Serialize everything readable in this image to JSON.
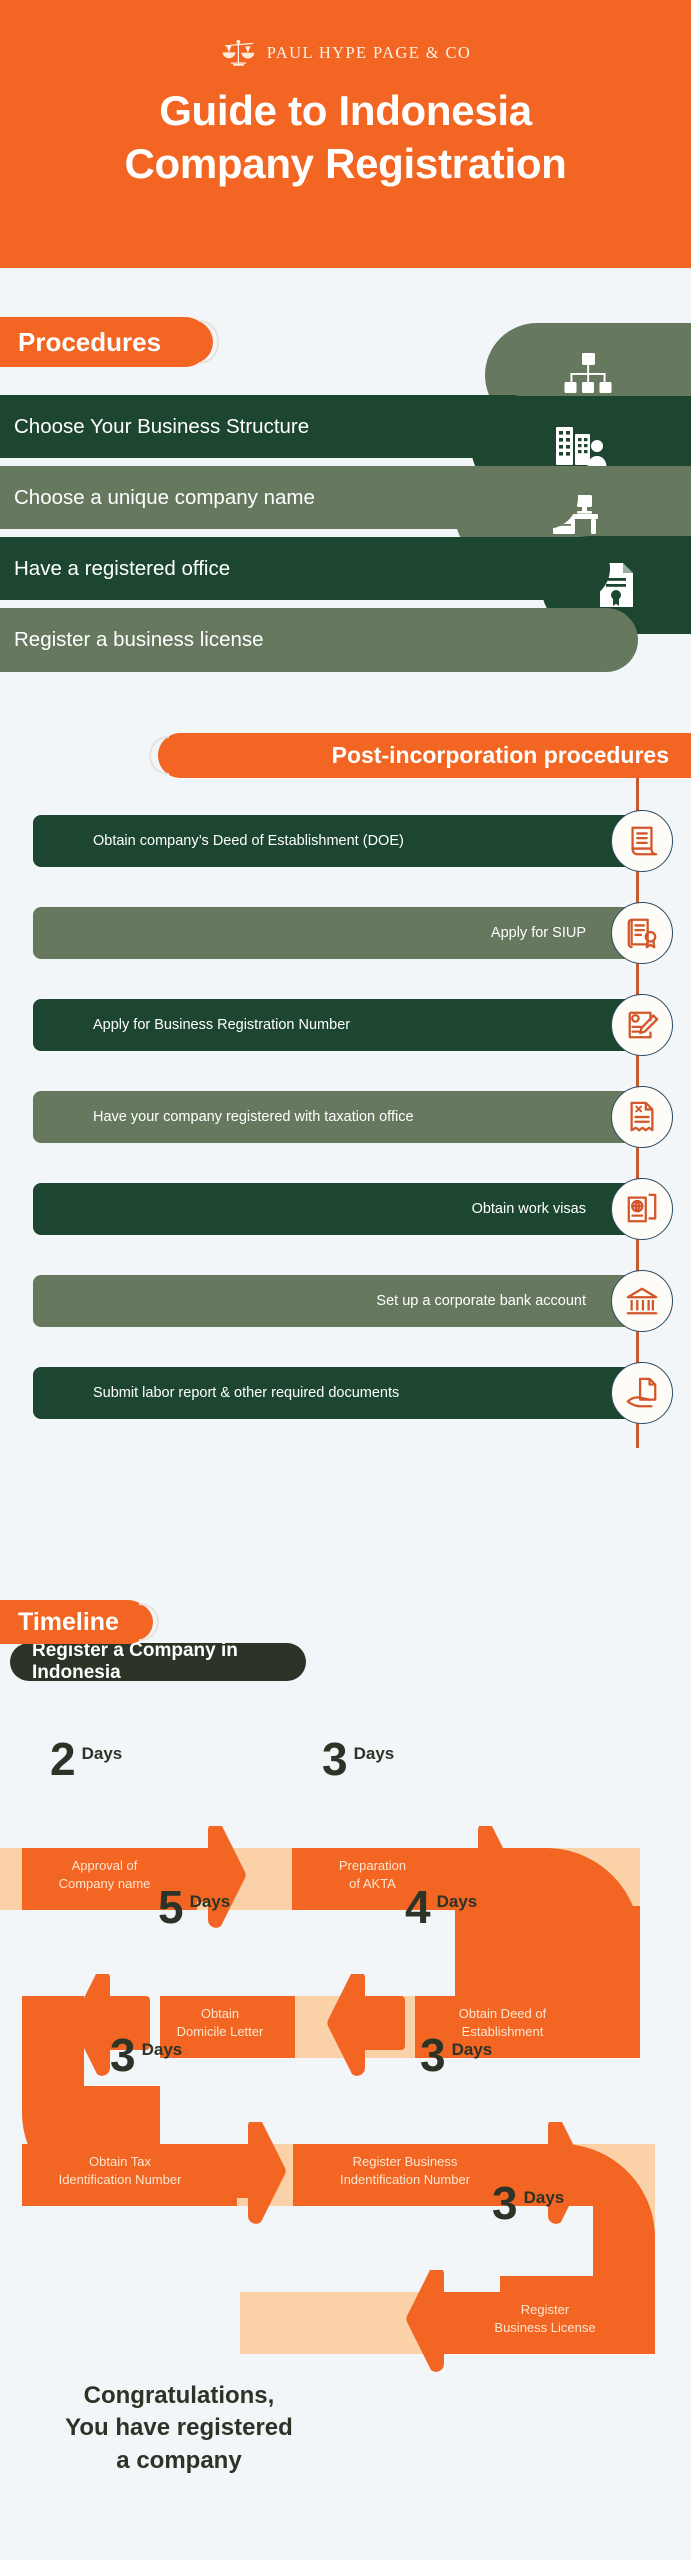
{
  "brand": {
    "orange": "#f26522",
    "orange_light": "#fbd2a8",
    "green_dark": "#1d4630",
    "green_light": "#66795f",
    "ink": "#2c3327",
    "background": "#f2f6f8",
    "logo_text": "PAUL HYPE PAGE & CO",
    "logo_icon": "scales-of-justice-icon"
  },
  "header": {
    "title_line1": "Guide to Indonesia",
    "title_line2": "Company Registration"
  },
  "procedures": {
    "section_label": "Procedures",
    "items": [
      {
        "label": "Choose Your Business Structure",
        "tone": "dark",
        "icon": "org-chart-icon"
      },
      {
        "label": "Choose a unique company name",
        "tone": "light",
        "icon": "building-person-icon"
      },
      {
        "label": "Have a registered office",
        "tone": "dark",
        "icon": "office-desk-icon"
      },
      {
        "label": "Register a business license",
        "tone": "light",
        "icon": "license-document-icon"
      }
    ]
  },
  "post_incorporation": {
    "section_label": "Post-incorporation procedures",
    "items": [
      {
        "label": "Obtain company’s Deed of Establishment (DOE)",
        "tone": "dark",
        "align": "left",
        "icon": "scroll-document-icon"
      },
      {
        "label": "Apply for SIUP",
        "tone": "light",
        "align": "right",
        "icon": "certificate-seal-icon"
      },
      {
        "label": "Apply for Business Registration Number",
        "tone": "dark",
        "align": "left",
        "icon": "signing-document-icon"
      },
      {
        "label": "Have your company registered with taxation office",
        "tone": "light",
        "align": "left",
        "icon": "tax-receipt-icon"
      },
      {
        "label": "Obtain work visas",
        "tone": "dark",
        "align": "right",
        "icon": "passport-globe-icon"
      },
      {
        "label": "Set up a corporate bank account",
        "tone": "light",
        "align": "right",
        "icon": "bank-icon"
      },
      {
        "label": "Submit labor report & other required documents",
        "tone": "dark",
        "align": "left",
        "icon": "hand-document-icon"
      }
    ]
  },
  "timeline": {
    "section_label": "Timeline",
    "subtitle": "Register a Company in Indonesia",
    "unit": "Days",
    "steps": [
      {
        "days": "2",
        "label": "Approval of\nCompany name",
        "direction": "right"
      },
      {
        "days": "3",
        "label": "Preparation\nof AKTA",
        "direction": "right"
      },
      {
        "days": "4",
        "label": "Obtain Deed of\nEstablishment",
        "direction": "left"
      },
      {
        "days": "5",
        "label": "Obtain\nDomicile Letter",
        "direction": "left"
      },
      {
        "days": "3",
        "label": "Obtain Tax\nIdentification Number",
        "direction": "right"
      },
      {
        "days": "3",
        "label": "Register Business\nIndentification Number",
        "direction": "right"
      },
      {
        "days": "3",
        "label": "Register\nBusiness License",
        "direction": "left"
      }
    ],
    "conclusion": "Congratulations,\nYou have registered\na company"
  }
}
